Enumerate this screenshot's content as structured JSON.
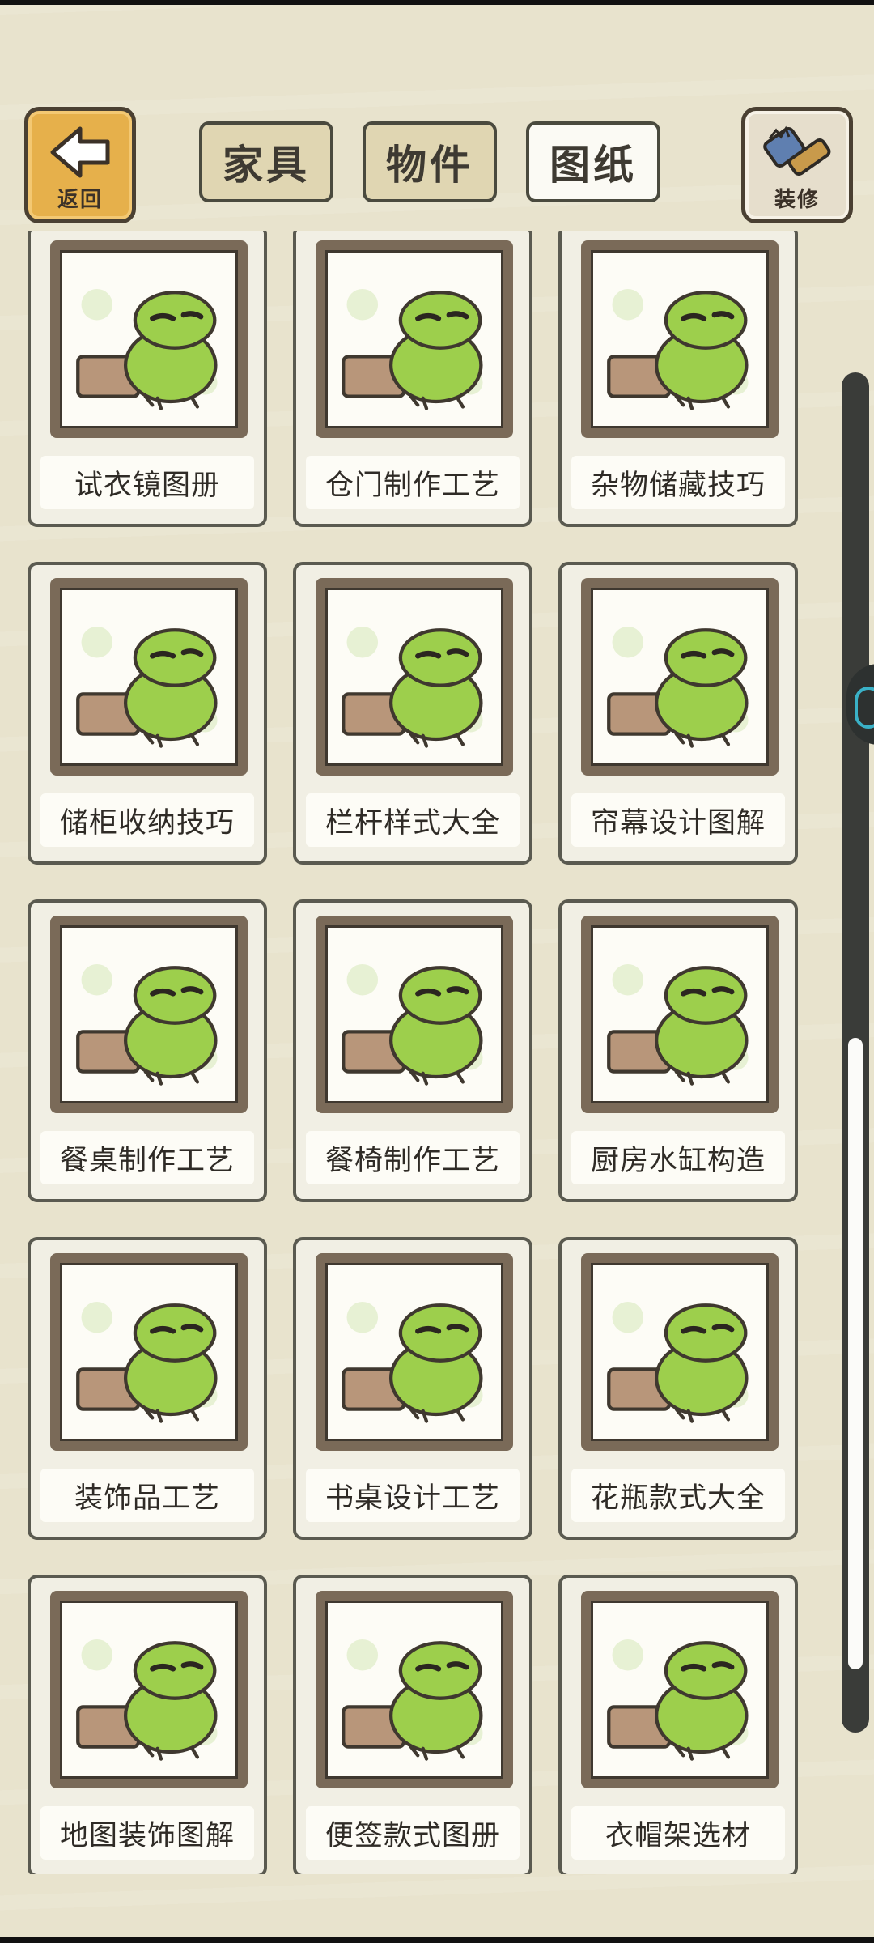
{
  "header": {
    "back_label": "返回",
    "decorate_label": "装修",
    "tabs": [
      {
        "label": "家具",
        "active": false
      },
      {
        "label": "物件",
        "active": false
      },
      {
        "label": "图纸",
        "active": true
      }
    ]
  },
  "items": [
    {
      "title": "试衣镜图册",
      "icon": "mirror-icon"
    },
    {
      "title": "仓门制作工艺",
      "icon": "door-icon"
    },
    {
      "title": "杂物储藏技巧",
      "icon": "storage-icon"
    },
    {
      "title": "储柜收纳技巧",
      "icon": "cabinet-icon"
    },
    {
      "title": "栏杆样式大全",
      "icon": "railing-icon"
    },
    {
      "title": "帘幕设计图解",
      "icon": "curtain-icon"
    },
    {
      "title": "餐桌制作工艺",
      "icon": "table-icon"
    },
    {
      "title": "餐椅制作工艺",
      "icon": "chair-icon"
    },
    {
      "title": "厨房水缸构造",
      "icon": "water-jar-icon"
    },
    {
      "title": "装饰品工艺",
      "icon": "ornament-icon"
    },
    {
      "title": "书桌设计工艺",
      "icon": "desk-icon"
    },
    {
      "title": "花瓶款式大全",
      "icon": "vase-icon"
    },
    {
      "title": "地图装饰图解",
      "icon": "map-icon"
    },
    {
      "title": "便签款式图册",
      "icon": "note-icon"
    },
    {
      "title": "衣帽架选材",
      "icon": "coat-rack-icon"
    }
  ],
  "colors": {
    "background": "#e8e3cd",
    "frog_green": "#9dcf4c",
    "frame_brown": "#7a6a58",
    "back_button": "#e6b04b"
  }
}
